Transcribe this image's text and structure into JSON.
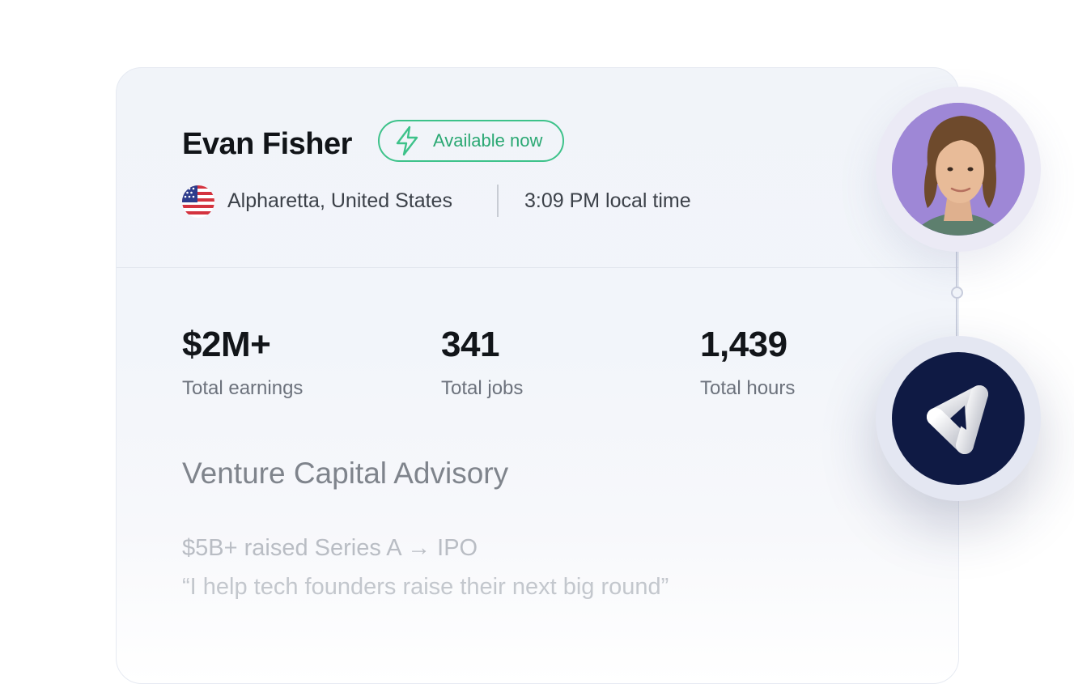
{
  "profile": {
    "name": "Evan Fisher",
    "availability": "Available now",
    "location": "Alpharetta, United States",
    "local_time": "3:09 PM local time",
    "flag_icon": "us-flag-icon"
  },
  "stats": [
    {
      "value": "$2M+",
      "label": "Total earnings"
    },
    {
      "value": "341",
      "label": "Total jobs"
    },
    {
      "value": "1,439",
      "label": "Total hours"
    }
  ],
  "specialty": {
    "title": "Venture Capital Advisory",
    "highlight": "$5B+ raised Series A → IPO",
    "quote": "“I help tech founders raise their next big round”"
  },
  "colors": {
    "accent_green": "#3dc28a",
    "logo_background": "#0f1a44",
    "avatar_background": "#9e87d6"
  }
}
